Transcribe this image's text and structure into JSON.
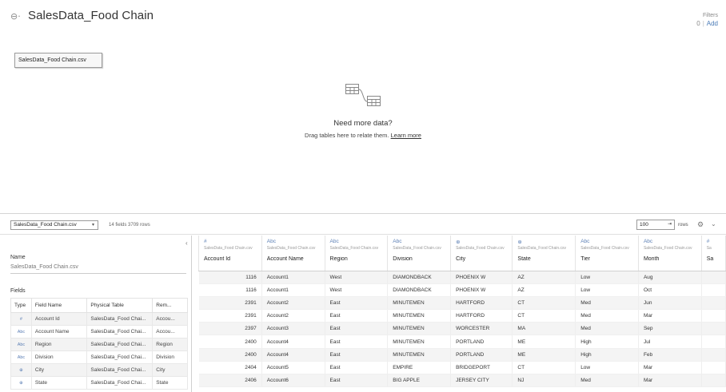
{
  "header": {
    "title": "SalesData_Food Chain",
    "filters_label": "Filters",
    "filters_count": "0",
    "filters_separator": "|",
    "filters_add": "Add"
  },
  "canvas": {
    "table_chip": "SalesData_Food Chain.csv",
    "need_more_data": "Need more data?",
    "drag_text": "Drag tables here to relate them.",
    "learn_more": "Learn more"
  },
  "toolbar": {
    "table_select": "SalesData_Food Chain.csv",
    "field_count": "14 fields 3709 rows",
    "rows_value": "100",
    "rows_label": "rows"
  },
  "left_panel": {
    "name_label": "Name",
    "name_value": "SalesData_Food Chain.csv",
    "fields_label": "Fields",
    "columns": [
      "Type",
      "Field Name",
      "Physical Table",
      "Rem..."
    ],
    "rows": [
      {
        "type": "#",
        "field": "Account Id",
        "table": "SalesData_Food Chai...",
        "remote": "Accou..."
      },
      {
        "type": "Abc",
        "field": "Account Name",
        "table": "SalesData_Food Chai...",
        "remote": "Accou..."
      },
      {
        "type": "Abc",
        "field": "Region",
        "table": "SalesData_Food Chai...",
        "remote": "Region"
      },
      {
        "type": "Abc",
        "field": "Division",
        "table": "SalesData_Food Chai...",
        "remote": "Division"
      },
      {
        "type": "⊕",
        "field": "City",
        "table": "SalesData_Food Chai...",
        "remote": "City"
      },
      {
        "type": "⊕",
        "field": "State",
        "table": "SalesData_Food Chai...",
        "remote": "State"
      }
    ]
  },
  "grid": {
    "columns": [
      {
        "type": "#",
        "source": "SalesData_Food Chain.csv",
        "name": "Account Id"
      },
      {
        "type": "Abc",
        "source": "SalesData_Food Chain.csv",
        "name": "Account Name"
      },
      {
        "type": "Abc",
        "source": "SalesData_Food Chain.csv",
        "name": "Region"
      },
      {
        "type": "Abc",
        "source": "SalesData_Food Chain.csv",
        "name": "Division"
      },
      {
        "type": "⊕",
        "source": "SalesData_Food Chain.csv",
        "name": "City"
      },
      {
        "type": "⊕",
        "source": "SalesData_Food Chain.csv",
        "name": "State"
      },
      {
        "type": "Abc",
        "source": "SalesData_Food Chain.csv",
        "name": "Tier"
      },
      {
        "type": "Abc",
        "source": "SalesData_Food Chain.csv",
        "name": "Month"
      },
      {
        "type": "#",
        "source": "Sa",
        "name": "Sa"
      }
    ],
    "rows": [
      [
        "1116",
        "Account1",
        "West",
        "DIAMONDBACK",
        "PHOENIX W",
        "AZ",
        "Low",
        "Aug",
        ""
      ],
      [
        "1116",
        "Account1",
        "West",
        "DIAMONDBACK",
        "PHOENIX W",
        "AZ",
        "Low",
        "Oct",
        ""
      ],
      [
        "2391",
        "Account2",
        "East",
        "MINUTEMEN",
        "HARTFORD",
        "CT",
        "Med",
        "Jun",
        ""
      ],
      [
        "2391",
        "Account2",
        "East",
        "MINUTEMEN",
        "HARTFORD",
        "CT",
        "Med",
        "Mar",
        ""
      ],
      [
        "2397",
        "Account3",
        "East",
        "MINUTEMEN",
        "WORCESTER",
        "MA",
        "Med",
        "Sep",
        ""
      ],
      [
        "2400",
        "Account4",
        "East",
        "MINUTEMEN",
        "PORTLAND",
        "ME",
        "High",
        "Jul",
        ""
      ],
      [
        "2400",
        "Account4",
        "East",
        "MINUTEMEN",
        "PORTLAND",
        "ME",
        "High",
        "Feb",
        ""
      ],
      [
        "2404",
        "Account5",
        "East",
        "EMPIRE",
        "BRIDGEPORT",
        "CT",
        "Low",
        "Mar",
        ""
      ],
      [
        "2406",
        "Account6",
        "East",
        "BIG APPLE",
        "JERSEY CITY",
        "NJ",
        "Med",
        "Mar",
        ""
      ]
    ]
  },
  "icons": {
    "datasource": "datasource-icon",
    "join": "join-tables-icon",
    "gear": "gear-icon",
    "collapse": "chevron-left-icon"
  }
}
